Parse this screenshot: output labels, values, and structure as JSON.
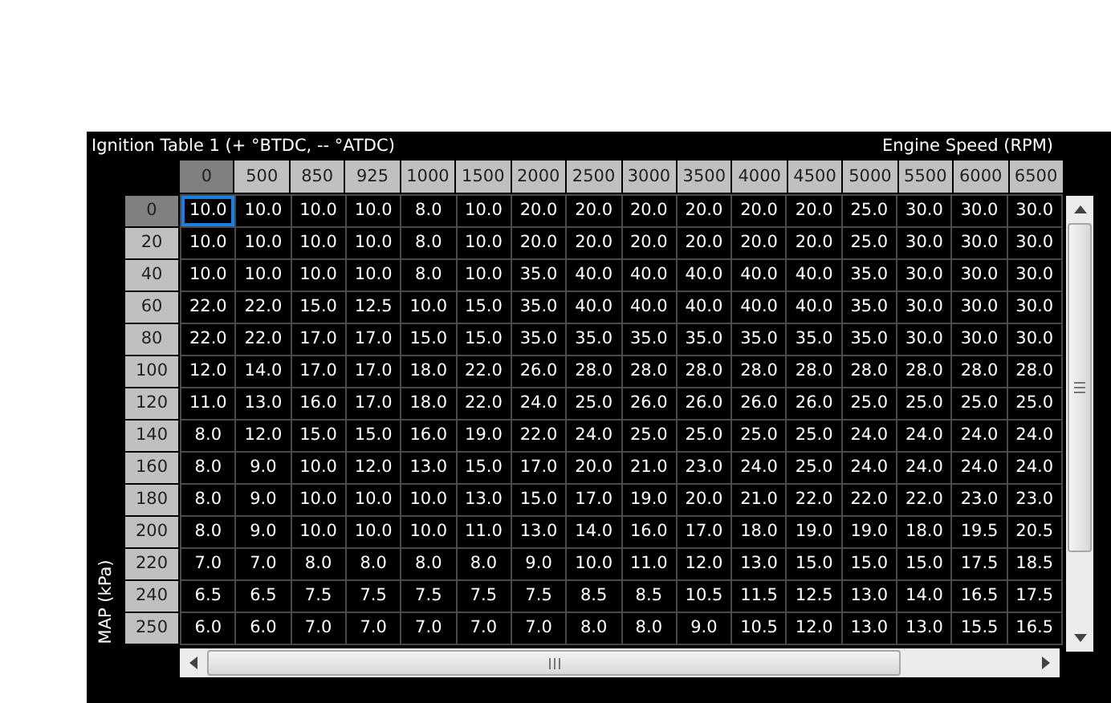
{
  "table": {
    "title": "Ignition Table 1 (+ °BTDC, -- °ATDC)",
    "x_axis_label": "Engine Speed (RPM)",
    "y_axis_label": "MAP (kPa)",
    "columns": [
      {
        "label": "0",
        "selected": true
      },
      {
        "label": "500",
        "selected": false
      },
      {
        "label": "850",
        "selected": false
      },
      {
        "label": "925",
        "selected": false
      },
      {
        "label": "1000",
        "selected": false
      },
      {
        "label": "1500",
        "selected": false
      },
      {
        "label": "2000",
        "selected": false
      },
      {
        "label": "2500",
        "selected": false
      },
      {
        "label": "3000",
        "selected": false
      },
      {
        "label": "3500",
        "selected": false
      },
      {
        "label": "4000",
        "selected": false
      },
      {
        "label": "4500",
        "selected": false
      },
      {
        "label": "5000",
        "selected": false
      },
      {
        "label": "5500",
        "selected": false
      },
      {
        "label": "6000",
        "selected": false
      },
      {
        "label": "6500",
        "selected": false
      }
    ],
    "rows": [
      {
        "label": "0",
        "selected": true,
        "cells": [
          "10.0",
          "10.0",
          "10.0",
          "10.0",
          "8.0",
          "10.0",
          "20.0",
          "20.0",
          "20.0",
          "20.0",
          "20.0",
          "20.0",
          "25.0",
          "30.0",
          "30.0",
          "30.0"
        ]
      },
      {
        "label": "20",
        "selected": false,
        "cells": [
          "10.0",
          "10.0",
          "10.0",
          "10.0",
          "8.0",
          "10.0",
          "20.0",
          "20.0",
          "20.0",
          "20.0",
          "20.0",
          "20.0",
          "25.0",
          "30.0",
          "30.0",
          "30.0"
        ]
      },
      {
        "label": "40",
        "selected": false,
        "cells": [
          "10.0",
          "10.0",
          "10.0",
          "10.0",
          "8.0",
          "10.0",
          "35.0",
          "40.0",
          "40.0",
          "40.0",
          "40.0",
          "40.0",
          "35.0",
          "30.0",
          "30.0",
          "30.0"
        ]
      },
      {
        "label": "60",
        "selected": false,
        "cells": [
          "22.0",
          "22.0",
          "15.0",
          "12.5",
          "10.0",
          "15.0",
          "35.0",
          "40.0",
          "40.0",
          "40.0",
          "40.0",
          "40.0",
          "35.0",
          "30.0",
          "30.0",
          "30.0"
        ]
      },
      {
        "label": "80",
        "selected": false,
        "cells": [
          "22.0",
          "22.0",
          "17.0",
          "17.0",
          "15.0",
          "15.0",
          "35.0",
          "35.0",
          "35.0",
          "35.0",
          "35.0",
          "35.0",
          "35.0",
          "30.0",
          "30.0",
          "30.0"
        ]
      },
      {
        "label": "100",
        "selected": false,
        "cells": [
          "12.0",
          "14.0",
          "17.0",
          "17.0",
          "18.0",
          "22.0",
          "26.0",
          "28.0",
          "28.0",
          "28.0",
          "28.0",
          "28.0",
          "28.0",
          "28.0",
          "28.0",
          "28.0"
        ]
      },
      {
        "label": "120",
        "selected": false,
        "cells": [
          "11.0",
          "13.0",
          "16.0",
          "17.0",
          "18.0",
          "22.0",
          "24.0",
          "25.0",
          "26.0",
          "26.0",
          "26.0",
          "26.0",
          "25.0",
          "25.0",
          "25.0",
          "25.0"
        ]
      },
      {
        "label": "140",
        "selected": false,
        "cells": [
          "8.0",
          "12.0",
          "15.0",
          "15.0",
          "16.0",
          "19.0",
          "22.0",
          "24.0",
          "25.0",
          "25.0",
          "25.0",
          "25.0",
          "24.0",
          "24.0",
          "24.0",
          "24.0"
        ]
      },
      {
        "label": "160",
        "selected": false,
        "cells": [
          "8.0",
          "9.0",
          "10.0",
          "12.0",
          "13.0",
          "15.0",
          "17.0",
          "20.0",
          "21.0",
          "23.0",
          "24.0",
          "25.0",
          "24.0",
          "24.0",
          "24.0",
          "24.0"
        ]
      },
      {
        "label": "180",
        "selected": false,
        "cells": [
          "8.0",
          "9.0",
          "10.0",
          "10.0",
          "10.0",
          "13.0",
          "15.0",
          "17.0",
          "19.0",
          "20.0",
          "21.0",
          "22.0",
          "22.0",
          "22.0",
          "23.0",
          "23.0"
        ]
      },
      {
        "label": "200",
        "selected": false,
        "cells": [
          "8.0",
          "9.0",
          "10.0",
          "10.0",
          "10.0",
          "11.0",
          "13.0",
          "14.0",
          "16.0",
          "17.0",
          "18.0",
          "19.0",
          "19.0",
          "18.0",
          "19.5",
          "20.5"
        ]
      },
      {
        "label": "220",
        "selected": false,
        "cells": [
          "7.0",
          "7.0",
          "8.0",
          "8.0",
          "8.0",
          "8.0",
          "9.0",
          "10.0",
          "11.0",
          "12.0",
          "13.0",
          "15.0",
          "15.0",
          "15.0",
          "17.5",
          "18.5"
        ]
      },
      {
        "label": "240",
        "selected": false,
        "cells": [
          "6.5",
          "6.5",
          "7.5",
          "7.5",
          "7.5",
          "7.5",
          "7.5",
          "8.5",
          "8.5",
          "10.5",
          "11.5",
          "12.5",
          "13.0",
          "14.0",
          "16.5",
          "17.5"
        ]
      },
      {
        "label": "250",
        "selected": false,
        "cells": [
          "6.0",
          "6.0",
          "7.0",
          "7.0",
          "7.0",
          "7.0",
          "7.0",
          "8.0",
          "8.0",
          "9.0",
          "10.5",
          "12.0",
          "13.0",
          "13.0",
          "15.5",
          "16.5"
        ]
      }
    ]
  }
}
